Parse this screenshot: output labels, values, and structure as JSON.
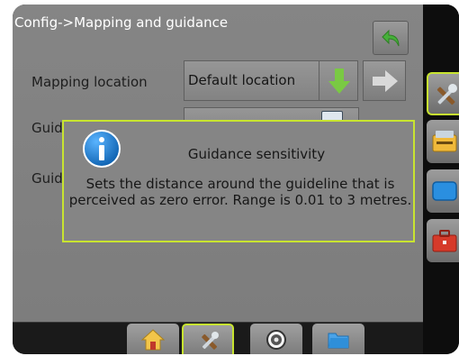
{
  "header": {
    "title": "Config->Mapping and guidance",
    "back_icon": "back-arrow-icon"
  },
  "rows": [
    {
      "label": "Mapping location",
      "value": "Default location"
    },
    {
      "label": "Guid",
      "value": ""
    },
    {
      "label": "Guid",
      "value": ""
    }
  ],
  "popup": {
    "title": "Guidance sensitivity",
    "body": "Sets the distance around the guideline that is perceived as zero error. Range is 0.01 to 3 metres.",
    "icon": "info-icon"
  },
  "side_tabs": [
    {
      "name": "tools",
      "icon": "tools-icon",
      "active": true
    },
    {
      "name": "console",
      "icon": "console-icon",
      "active": false
    },
    {
      "name": "display",
      "icon": "screen-icon",
      "active": false
    },
    {
      "name": "toolbox",
      "icon": "toolbox-icon",
      "active": false
    }
  ],
  "bottom_tabs": [
    {
      "name": "home",
      "icon": "home-icon",
      "active": false
    },
    {
      "name": "configuration",
      "icon": "tools-icon",
      "active": true
    },
    {
      "name": "guidance",
      "icon": "target-icon",
      "active": false
    },
    {
      "name": "data",
      "icon": "folder-icon",
      "active": false
    }
  ],
  "colors": {
    "highlight": "#c8e430",
    "download_arrow": "#7ac943",
    "info_blue": "#1a7fd6"
  }
}
